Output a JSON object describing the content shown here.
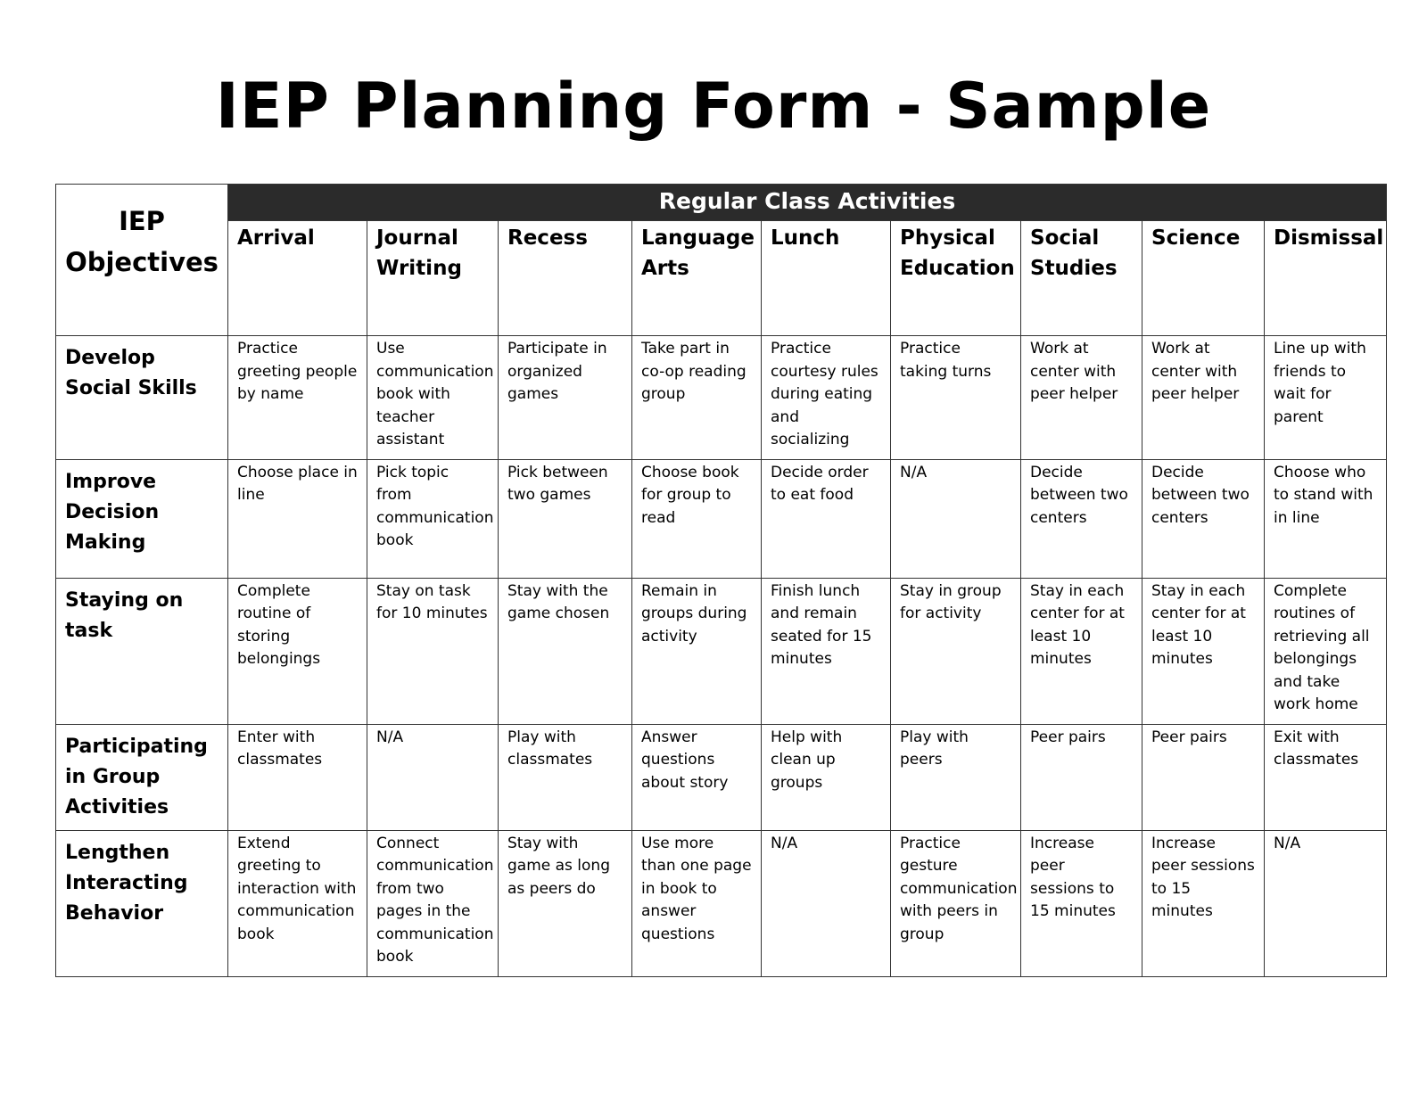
{
  "title": "IEP Planning Form - Sample",
  "table": {
    "corner_label": "IEP Objectives",
    "band_label": "Regular Class Activities",
    "columns": [
      "Arrival",
      "Journal Writing",
      "Recess",
      "Language Arts",
      "Lunch",
      "Physical Education",
      "Social Studies",
      "Science",
      "Dismissal"
    ],
    "rows": [
      {
        "objective": "Develop Social Skills",
        "cells": [
          "Practice greeting people by name",
          "Use communication book with teacher assistant",
          "Participate in organized games",
          "Take part in co-op reading group",
          "Practice courtesy rules during eating and socializing",
          "Practice taking turns",
          "Work at center with peer helper",
          "Work at center with peer helper",
          "Line up with friends to wait for parent"
        ]
      },
      {
        "objective": "Improve Decision Making",
        "cells": [
          "Choose place in line",
          "Pick topic from communication book",
          "Pick between two games",
          "Choose book for group to read",
          "Decide order to eat food",
          "N/A",
          "Decide between two centers",
          "Decide between two centers",
          "Choose who to stand with in line"
        ]
      },
      {
        "objective": "Staying on task",
        "cells": [
          "Complete routine of storing belongings",
          "Stay on task for 10 minutes",
          "Stay with the game chosen",
          "Remain in groups during activity",
          "Finish lunch and remain seated for 15 minutes",
          "Stay in group for activity",
          "Stay in each center for at least 10 minutes",
          "Stay in each center for at least 10 minutes",
          "Complete routines of retrieving all belongings and take work home"
        ]
      },
      {
        "objective": "Participating in Group Activities",
        "cells": [
          "Enter with classmates",
          "N/A",
          "Play with classmates",
          "Answer questions about story",
          "Help with clean up groups",
          "Play with peers",
          "Peer pairs",
          "Peer pairs",
          "Exit with classmates"
        ]
      },
      {
        "objective": "Lengthen Interacting Behavior",
        "cells": [
          "Extend greeting to interaction with communication book",
          "Connect communication from two pages in the communication book",
          "Stay with game as long as peers do",
          "Use more than one page in book to answer questions",
          "N/A",
          "Practice gesture communication with peers in group",
          "Increase peer sessions to 15 minutes",
          "Increase peer sessions to 15 minutes",
          "N/A"
        ]
      }
    ]
  }
}
